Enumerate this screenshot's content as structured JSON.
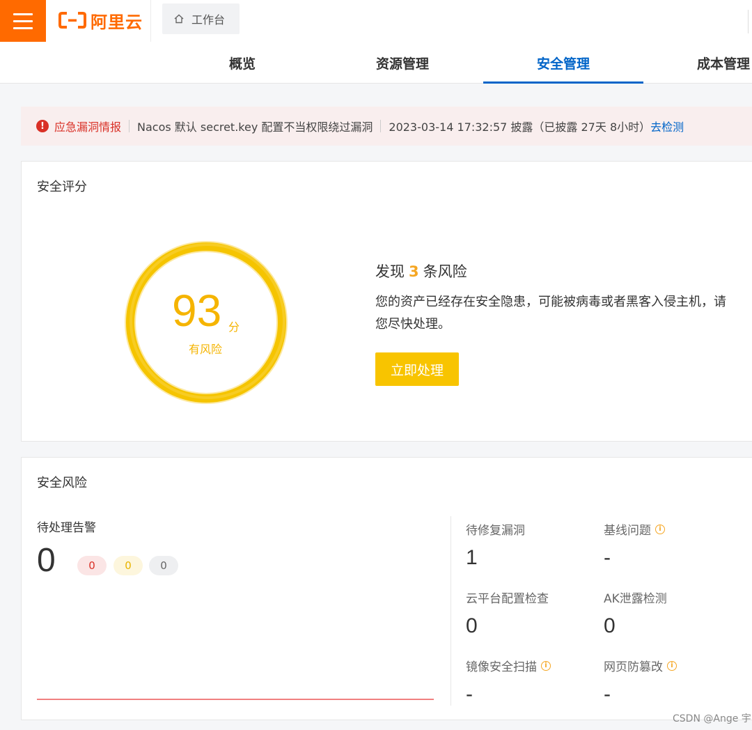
{
  "brand": {
    "name": "阿里云",
    "color": "#ff6a00"
  },
  "header": {
    "workbench_label": "工作台",
    "workbench_icon": "home-icon"
  },
  "tabs": [
    {
      "label": "概览",
      "active": false
    },
    {
      "label": "资源管理",
      "active": false
    },
    {
      "label": "安全管理",
      "active": true
    },
    {
      "label": "成本管理",
      "active": false
    }
  ],
  "alert": {
    "title": "应急漏洞情报",
    "message": "Nacos 默认 secret.key 配置不当权限绕过漏洞",
    "time_text": "2023-03-14 17:32:57 披露（已披露 27天 8小时）",
    "link_label": "去检测"
  },
  "score_card": {
    "title": "安全评分",
    "score": "93",
    "unit": "分",
    "status": "有风险",
    "risk_prefix": "发现",
    "risk_count": "3",
    "risk_suffix": "条风险",
    "description": "您的资产已经存在安全隐患，可能被病毒或者黑客入侵主机，请您尽快处理。",
    "action_label": "立即处理",
    "accent_color": "#f8c400"
  },
  "risk_card": {
    "title": "安全风险",
    "alerts_label": "待处理告警",
    "alerts_total": "0",
    "alerts_breakdown": [
      "0",
      "0",
      "0"
    ],
    "metrics": [
      {
        "label": "待修复漏洞",
        "value": "1",
        "info": false
      },
      {
        "label": "基线问题",
        "value": "-",
        "info": true
      },
      {
        "label": "云平台配置检查",
        "value": "0",
        "info": false
      },
      {
        "label": "AK泄露检测",
        "value": "0",
        "info": false
      },
      {
        "label": "镜像安全扫描",
        "value": "-",
        "info": true
      },
      {
        "label": "网页防篡改",
        "value": "-",
        "info": true
      }
    ]
  },
  "watermark": "CSDN @Ange 宇"
}
